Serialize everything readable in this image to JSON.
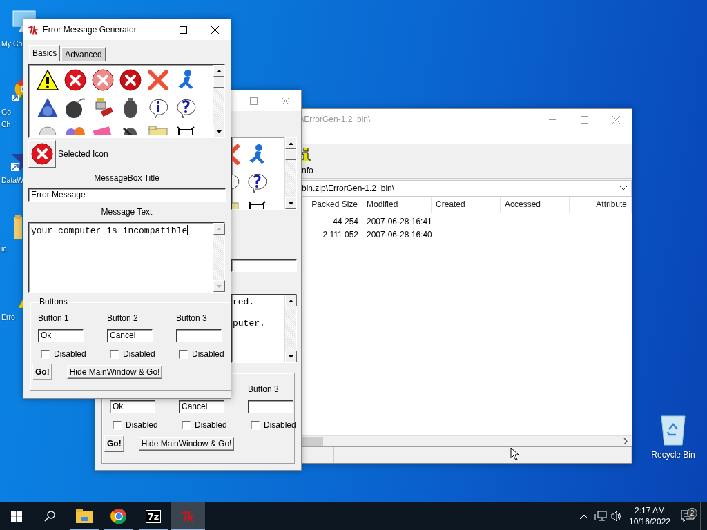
{
  "desktop": {
    "icons": [
      {
        "kind": "computer",
        "lines": [
          "My Co"
        ]
      },
      {
        "kind": "browser",
        "lines": [
          "Go",
          "Ch"
        ]
      },
      {
        "kind": "network",
        "lines": [
          "DataW"
        ]
      },
      {
        "kind": "folder",
        "lines": [
          "ic"
        ]
      },
      {
        "kind": "warning",
        "lines": [
          "Erro"
        ]
      }
    ],
    "recycle_bin": {
      "label": "Recycle Bin"
    }
  },
  "archive_window": {
    "title": "\\ErrorGen-1.2_bin\\",
    "toolbar": [
      {
        "label": "nfo"
      }
    ],
    "address": "bin.zip\\ErrorGen-1.2_bin\\",
    "columns": [
      "Packed Size",
      "Modified",
      "Created",
      "Accessed",
      "Attribute"
    ],
    "rows": [
      {
        "packed_size": "44 254",
        "modified": "2007-06-28 16:41"
      },
      {
        "packed_size": "2 111 052",
        "modified": "2007-06-28 16:40"
      }
    ]
  },
  "back_window": {
    "message_lines": [
      "red.",
      "puter."
    ],
    "buttons": [
      {
        "value": "Ok",
        "checkbox": {
          "label": "Disabled",
          "checked": false
        }
      },
      {
        "value": "Cancel",
        "checkbox": {
          "label": "Disabled",
          "checked": false
        }
      },
      {
        "label": "Button 3",
        "checkbox": {
          "label": "Disabled",
          "checked": false
        }
      }
    ],
    "go": "Go!",
    "hide": "Hide MainWindow & Go!"
  },
  "main_window": {
    "title": "Error Message Generator",
    "tabs": [
      {
        "label": "Basics",
        "selected": true
      },
      {
        "label": "Advanced",
        "selected": false
      }
    ],
    "selected_icon_label": "Selected Icon",
    "title_label": "MessageBox Title",
    "title_value": "Error Message",
    "text_label": "Message Text",
    "text_value": "your computer is incompatible",
    "group_label": "Buttons",
    "buttons": [
      {
        "label": "Button 1",
        "value": "Ok",
        "checkbox": {
          "label": "Disabled",
          "checked": false
        }
      },
      {
        "label": "Button 2",
        "value": "Cancel",
        "checkbox": {
          "label": "Disabled",
          "checked": false
        }
      },
      {
        "label": "Button 3",
        "checkbox": {
          "label": "Disabled",
          "checked": false
        }
      }
    ],
    "go": "Go!",
    "hide": "Hide MainWindow & Go!"
  },
  "taskbar": {
    "apps": [
      {
        "kind": "files",
        "running": true,
        "selected": false
      },
      {
        "kind": "browser",
        "running": true,
        "selected": false
      },
      {
        "kind": "archiver",
        "label": "7z",
        "running": true,
        "selected": false
      },
      {
        "kind": "tk",
        "running": true,
        "selected": true
      }
    ],
    "clock": {
      "time": "2:17 AM",
      "date": "10/16/2022"
    },
    "notification_count": "2"
  }
}
